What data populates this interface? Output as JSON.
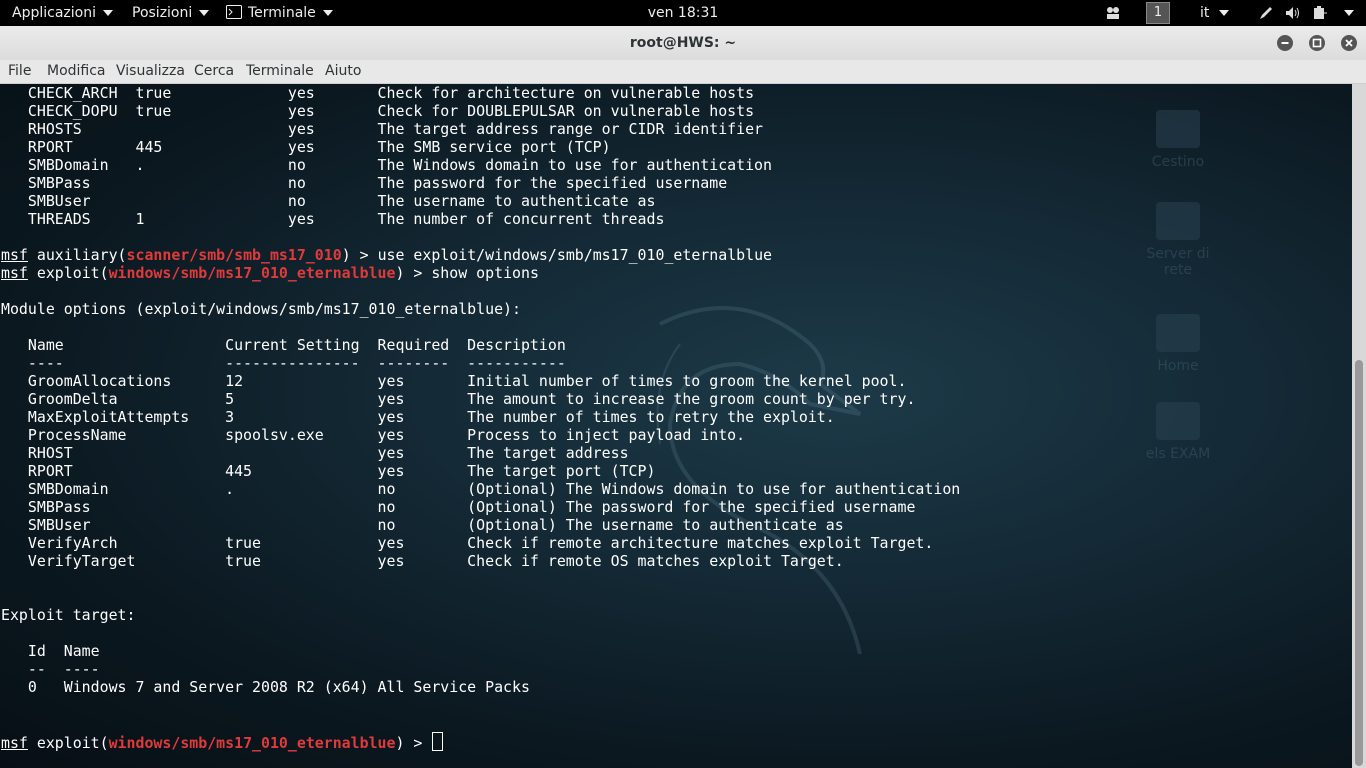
{
  "topbar": {
    "applications": "Applicazioni",
    "places": "Posizioni",
    "app_name": "Terminale",
    "clock": "ven 18:31",
    "workspace": "1",
    "language": "it"
  },
  "window": {
    "title": "root@HWS: ~"
  },
  "menu": [
    "File",
    "Modifica",
    "Visualizza",
    "Cerca",
    "Terminale",
    "Aiuto"
  ],
  "desktop_icons": [
    "Cestino",
    "Server di rete",
    "Home",
    "els EXAM"
  ],
  "terminal": {
    "lines": [
      "   CHECK_ARCH  true             yes       Check for architecture on vulnerable hosts",
      "   CHECK_DOPU  true             yes       Check for DOUBLEPULSAR on vulnerable hosts",
      "   RHOSTS                       yes       The target address range or CIDR identifier",
      "   RPORT       445              yes       The SMB service port (TCP)",
      "   SMBDomain   .                no        The Windows domain to use for authentication",
      "   SMBPass                      no        The password for the specified username",
      "   SMBUser                      no        The username to authenticate as",
      "   THREADS     1                yes       The number of concurrent threads",
      "",
      null,
      null,
      "",
      "Module options (exploit/windows/smb/ms17_010_eternalblue):",
      "",
      "   Name                  Current Setting  Required  Description",
      "   ----                  ---------------  --------  -----------",
      "   GroomAllocations      12               yes       Initial number of times to groom the kernel pool.",
      "   GroomDelta            5                yes       The amount to increase the groom count by per try.",
      "   MaxExploitAttempts    3                yes       The number of times to retry the exploit.",
      "   ProcessName           spoolsv.exe      yes       Process to inject payload into.",
      "   RHOST                                  yes       The target address",
      "   RPORT                 445              yes       The target port (TCP)",
      "   SMBDomain             .                no        (Optional) The Windows domain to use for authentication",
      "   SMBPass                                no        (Optional) The password for the specified username",
      "   SMBUser                                no        (Optional) The username to authenticate as",
      "   VerifyArch            true             yes       Check if remote architecture matches exploit Target.",
      "   VerifyTarget          true             yes       Check if remote OS matches exploit Target.",
      "",
      "",
      "Exploit target:",
      "",
      "   Id  Name",
      "   --  ----",
      "   0   Windows 7 and Server 2008 R2 (x64) All Service Packs",
      "",
      "",
      null
    ],
    "prompts": {
      "p1": {
        "msf": "msf",
        "pre": " auxiliary(",
        "module": "scanner/smb/smb_ms17_010",
        "post": ") > use exploit/windows/smb/ms17_010_eternalblue"
      },
      "p2": {
        "msf": "msf",
        "pre": " exploit(",
        "module": "windows/smb/ms17_010_eternalblue",
        "post": ") > show options"
      },
      "p3": {
        "msf": "msf",
        "pre": " exploit(",
        "module": "windows/smb/ms17_010_eternalblue",
        "post": ") > "
      }
    }
  }
}
